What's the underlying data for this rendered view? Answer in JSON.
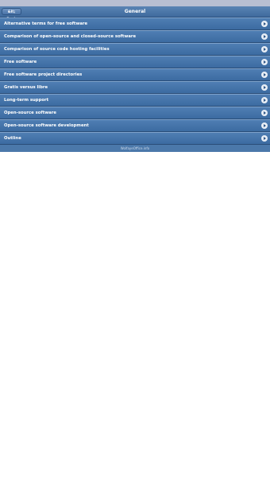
{
  "header": {
    "back_label": "&lt; Back",
    "title": "General"
  },
  "list": {
    "items": [
      {
        "label": "Alternative terms for free software",
        "icon": "chevron-right-icon"
      },
      {
        "label": "Comparison of open-source and closed-source software",
        "icon": "chevron-right-icon"
      },
      {
        "label": "Comparison of source code hosting facilities",
        "icon": "chevron-right-icon"
      },
      {
        "label": "Free software",
        "icon": "chevron-right-icon"
      },
      {
        "label": "Free software project directories",
        "icon": "chevron-right-icon"
      },
      {
        "label": "Gratis versus libre",
        "icon": "chevron-right-icon"
      },
      {
        "label": "Long-term support",
        "icon": "chevron-right-icon"
      },
      {
        "label": "Open-source software",
        "icon": "chevron-right-icon"
      },
      {
        "label": "Open-source software development",
        "icon": "chevron-right-icon"
      },
      {
        "label": "Outline",
        "icon": "chevron-right-icon"
      }
    ]
  },
  "footer": {
    "text": "WolfayeOffice.info"
  },
  "colors": {
    "list_background": "#4473a8",
    "top_strip": "#b9bfd2",
    "text": "#ffffff"
  }
}
